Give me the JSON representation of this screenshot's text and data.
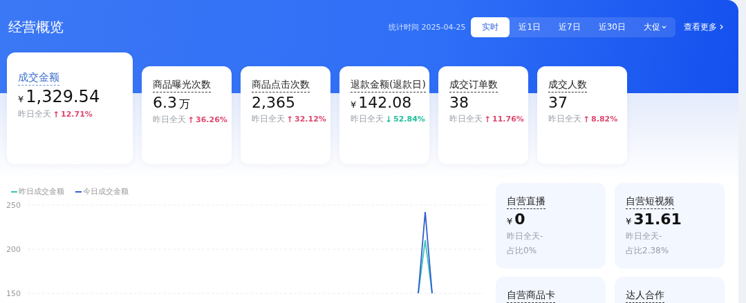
{
  "header": {
    "title": "经营概览",
    "stat_time": "统计时间 2025-04-25",
    "tabs": [
      {
        "label": "实时",
        "selected": true,
        "dropdown": false
      },
      {
        "label": "近1日",
        "selected": false,
        "dropdown": false
      },
      {
        "label": "近7日",
        "selected": false,
        "dropdown": false
      },
      {
        "label": "近30日",
        "selected": false,
        "dropdown": false
      },
      {
        "label": "大促",
        "selected": false,
        "dropdown": true
      }
    ],
    "more_link": "查看更多"
  },
  "metrics": [
    {
      "label": "成交金额",
      "currency": "¥",
      "value": "1,329.54",
      "compare": "昨日全天",
      "arrow": "↑",
      "change": "12.71%",
      "color": "#e0466e",
      "selected": true
    },
    {
      "label": "商品曝光次数",
      "value": "6.3",
      "unit": "万",
      "compare": "昨日全天",
      "arrow": "↑",
      "change": "36.26%",
      "color": "#e0466e",
      "selected": false
    },
    {
      "label": "商品点击次数",
      "value": "2,365",
      "compare": "昨日全天",
      "arrow": "↑",
      "change": "32.12%",
      "color": "#e0466e",
      "selected": false
    },
    {
      "label": "退款金额(退款日)",
      "currency": "¥",
      "value": "142.08",
      "compare": "昨日全天",
      "arrow": "↓",
      "change": "52.84%",
      "color": "#1fbf9a",
      "selected": false
    },
    {
      "label": "成交订单数",
      "value": "38",
      "compare": "昨日全天",
      "arrow": "↑",
      "change": "11.76%",
      "color": "#e0466e",
      "selected": false
    },
    {
      "label": "成交人数",
      "value": "37",
      "compare": "昨日全天",
      "arrow": "↑",
      "change": "8.82%",
      "color": "#e0466e",
      "selected": false
    }
  ],
  "chart": {
    "chart_data": {
      "type": "line",
      "ylim": [
        150,
        250
      ],
      "yticks": [
        150,
        200,
        250
      ],
      "series": [
        {
          "name": "昨日成交金额",
          "color": "#3cc4b4",
          "values": [
            null,
            null,
            null,
            null,
            null,
            null,
            null,
            null,
            null,
            null,
            null,
            null,
            null,
            null,
            null,
            null,
            null,
            null,
            null,
            null,
            null,
            null,
            null,
            null,
            null,
            null,
            null,
            null,
            null,
            null,
            null,
            null,
            null,
            null,
            null,
            null,
            null,
            null,
            null,
            null,
            null,
            null,
            null,
            null,
            null,
            null,
            null,
            null,
            null,
            null,
            null,
            null,
            null,
            null,
            null,
            null,
            150,
            210,
            150,
            null,
            null,
            null,
            null,
            null,
            null,
            null
          ]
        },
        {
          "name": "今日成交金额",
          "color": "#2f5fd0",
          "values": [
            null,
            null,
            null,
            null,
            null,
            null,
            null,
            null,
            null,
            null,
            null,
            null,
            null,
            null,
            null,
            null,
            null,
            null,
            null,
            null,
            null,
            null,
            null,
            null,
            null,
            null,
            null,
            null,
            null,
            null,
            null,
            null,
            null,
            null,
            null,
            null,
            null,
            null,
            null,
            null,
            null,
            null,
            null,
            null,
            null,
            null,
            null,
            null,
            null,
            null,
            null,
            null,
            null,
            null,
            null,
            null,
            150,
            242,
            150,
            null,
            null,
            null,
            null,
            null,
            null,
            null
          ]
        }
      ]
    }
  },
  "channels": [
    {
      "label": "自营直播",
      "currency": "¥",
      "value": "0",
      "compare": "昨日全天-",
      "share": "占比0%"
    },
    {
      "label": "自营短视频",
      "currency": "¥",
      "value": "31.61",
      "compare": "昨日全天-",
      "share": "占比2.38%"
    },
    {
      "label": "自营商品卡"
    },
    {
      "label": "达人合作"
    }
  ]
}
